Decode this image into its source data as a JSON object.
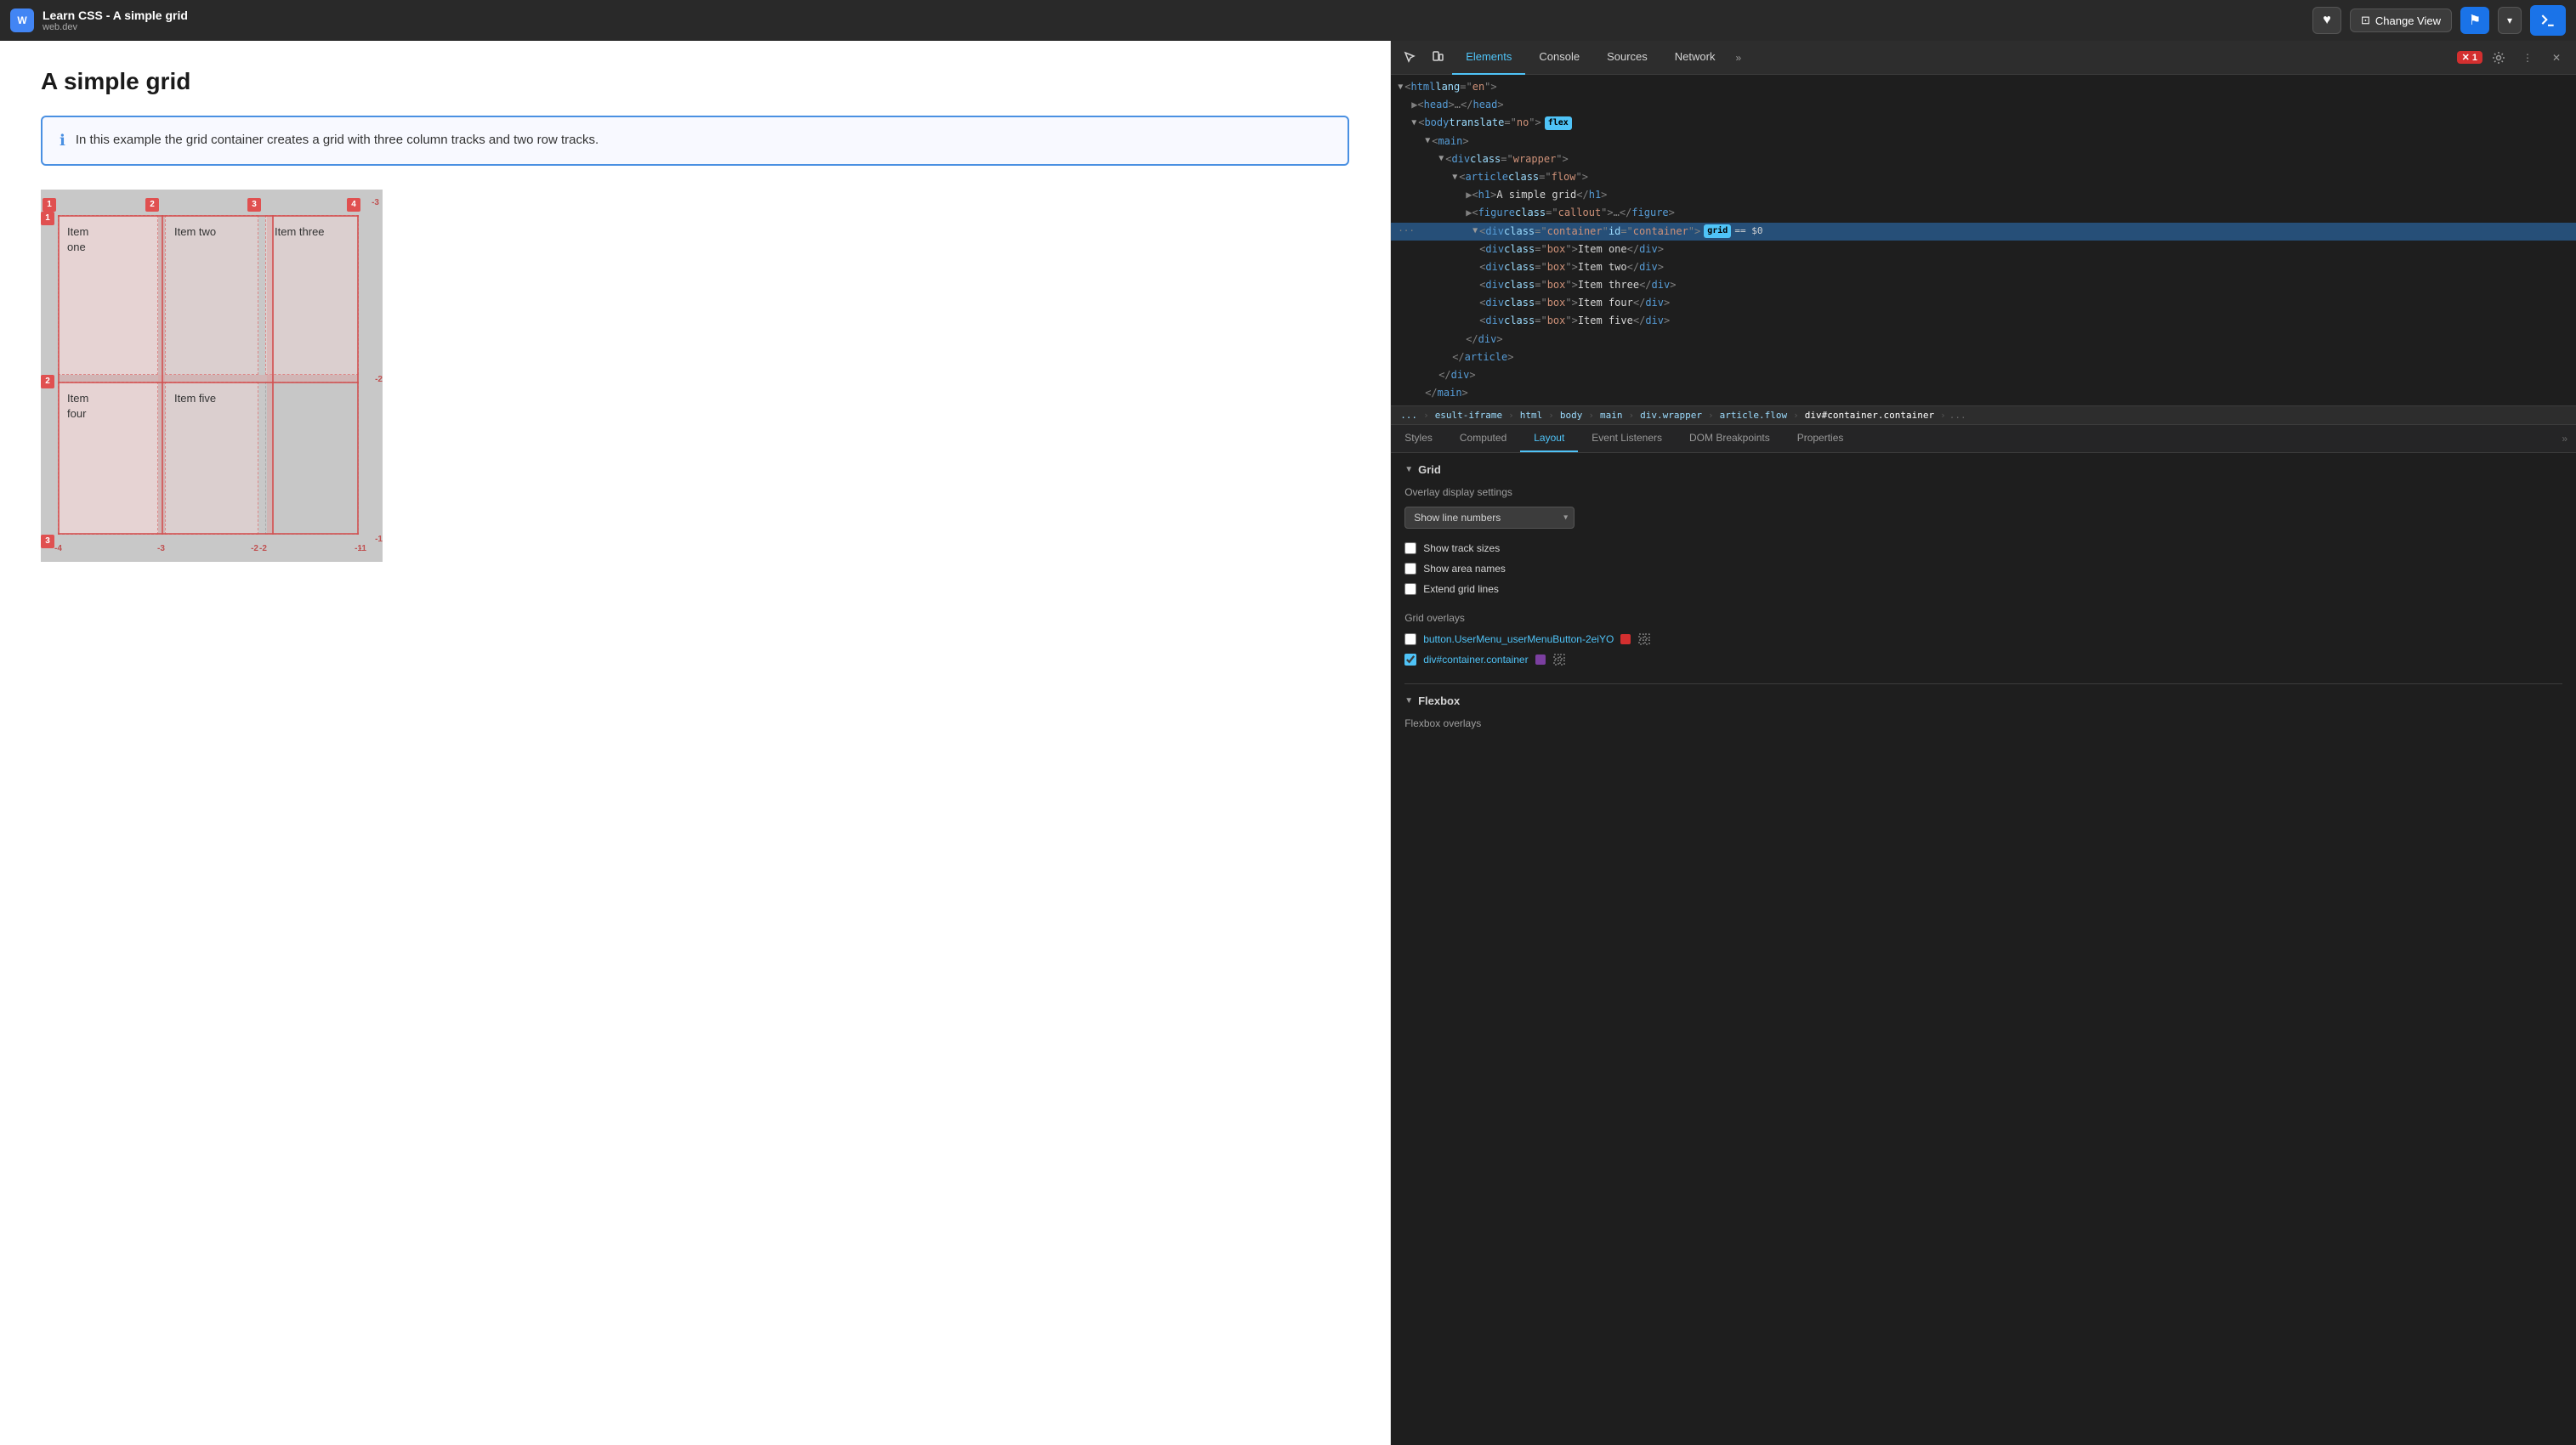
{
  "topbar": {
    "logo_text": "W",
    "title": "Learn CSS - A simple grid",
    "subtitle": "web.dev",
    "change_view_label": "Change View",
    "heart_icon": "♥",
    "bookmark_icon": "⚑",
    "dropdown_icon": "▾",
    "terminal_label": ">"
  },
  "preview": {
    "heading": "A simple grid",
    "info_text": "In this example the grid container creates a grid with three column tracks and two row tracks.",
    "grid_items": [
      "Item one",
      "Item two",
      "Item three",
      "Item four",
      "Item five"
    ]
  },
  "devtools": {
    "tabs": [
      {
        "label": "Elements",
        "active": true
      },
      {
        "label": "Console",
        "active": false
      },
      {
        "label": "Sources",
        "active": false
      },
      {
        "label": "Network",
        "active": false
      }
    ],
    "more_tabs": "»",
    "error_count": "1",
    "dom_tree": {
      "lines": [
        {
          "indent": 0,
          "content": "<html lang=\"en\">",
          "expanded": true
        },
        {
          "indent": 1,
          "content": "<head>…</head>",
          "expanded": false
        },
        {
          "indent": 1,
          "content": "<body translate=\"no\">",
          "badge": "flex",
          "expanded": true
        },
        {
          "indent": 2,
          "content": "<main>",
          "expanded": true
        },
        {
          "indent": 3,
          "content": "<div class=\"wrapper\">",
          "expanded": true
        },
        {
          "indent": 4,
          "content": "<article class=\"flow\">",
          "expanded": true
        },
        {
          "indent": 5,
          "content": "<h1>A simple grid</h1>",
          "expanded": false
        },
        {
          "indent": 5,
          "content": "<figure class=\"callout\">…</figure>",
          "expanded": false
        },
        {
          "indent": 5,
          "content": "<div class=\"container\" id=\"container\">",
          "badge": "grid",
          "eq_s0": true,
          "highlighted": true
        },
        {
          "indent": 6,
          "content": "<div class=\"box\">Item one</div>",
          "expanded": false
        },
        {
          "indent": 6,
          "content": "<div class=\"box\">Item two</div>",
          "expanded": false
        },
        {
          "indent": 6,
          "content": "<div class=\"box\">Item three</div>",
          "expanded": false
        },
        {
          "indent": 6,
          "content": "<div class=\"box\">Item four</div>",
          "expanded": false
        },
        {
          "indent": 6,
          "content": "<div class=\"box\">Item five</div>",
          "expanded": false
        },
        {
          "indent": 5,
          "content": "</div>",
          "expanded": false
        },
        {
          "indent": 4,
          "content": "</article>",
          "expanded": false
        },
        {
          "indent": 3,
          "content": "</div>",
          "expanded": false
        },
        {
          "indent": 2,
          "content": "</main>",
          "expanded": false
        }
      ]
    },
    "breadcrumb": {
      "items": [
        "...",
        "esult-iframe",
        "html",
        "body",
        "main",
        "div.wrapper",
        "article.flow",
        "div#container.container",
        "..."
      ]
    },
    "panel_tabs": [
      "Styles",
      "Computed",
      "Layout",
      "Event Listeners",
      "DOM Breakpoints",
      "Properties",
      "»"
    ],
    "active_panel_tab": "Layout",
    "layout": {
      "grid_section_title": "Grid",
      "overlay_settings_title": "Overlay display settings",
      "dropdown_options": [
        "Show line numbers",
        "Show track sizes",
        "Show area names",
        "Extend grid lines"
      ],
      "dropdown_selected": "Show line numbers",
      "checkboxes": [
        {
          "label": "Show track sizes",
          "checked": false
        },
        {
          "label": "Show area names",
          "checked": false
        },
        {
          "label": "Extend grid lines",
          "checked": false
        }
      ],
      "grid_overlays_title": "Grid overlays",
      "overlay_items": [
        {
          "label": "button.UserMenu_userMenuButton-2eiYO",
          "checked": false,
          "color": "#d32f2f"
        },
        {
          "label": "div#container.container",
          "checked": true,
          "color": "#7b3fa0"
        }
      ],
      "flexbox_section_title": "Flexbox",
      "flexbox_overlays_title": "Flexbox overlays"
    }
  }
}
